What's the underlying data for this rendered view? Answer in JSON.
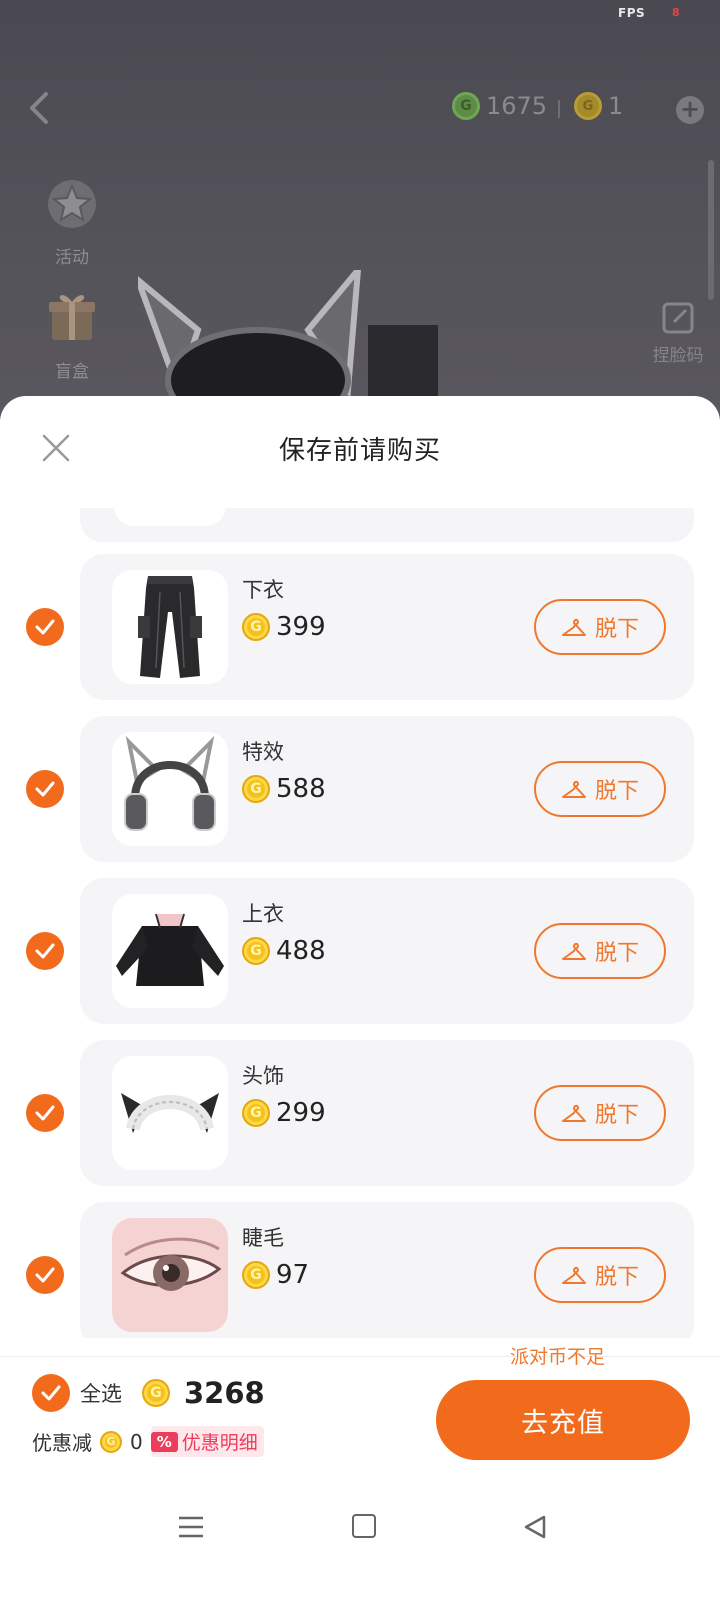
{
  "status": {
    "fps_label": "FPS",
    "fps_value": "8"
  },
  "background": {
    "currency_green": {
      "icon": "game-coin-green-icon",
      "value": "1675"
    },
    "currency_gold": {
      "icon": "party-coin-gold-icon",
      "value": "1"
    },
    "side_menu": [
      {
        "label": "活动",
        "icon": "star-event-icon"
      },
      {
        "label": "盲盒",
        "icon": "gift-box-icon"
      }
    ],
    "face_code_label": "捏脸码"
  },
  "sheet": {
    "title": "保存前请购买",
    "items": [
      {
        "name": "下衣",
        "price": "399",
        "remove_label": "脱下",
        "thumb": "black-cargo-pants"
      },
      {
        "name": "特效",
        "price": "588",
        "remove_label": "脱下",
        "thumb": "cat-ear-headphones"
      },
      {
        "name": "上衣",
        "price": "488",
        "remove_label": "脱下",
        "thumb": "black-off-shoulder-top"
      },
      {
        "name": "头饰",
        "price": "299",
        "remove_label": "脱下",
        "thumb": "maid-cat-headband"
      },
      {
        "name": "睫毛",
        "price": "97",
        "remove_label": "脱下",
        "thumb": "eyelash-eye"
      }
    ]
  },
  "footer": {
    "select_all_label": "全选",
    "total": "3268",
    "discount_label": "优惠减",
    "discount_value": "0",
    "discount_badge": "%",
    "discount_detail": "优惠明细",
    "insufficient_text": "派对币不足",
    "recharge_label": "去充值"
  },
  "colors": {
    "accent": "#f26b1d",
    "accent_text": "#f0782d",
    "card_bg": "#f5f5f7",
    "coin_gold": "#f3c21c",
    "discount_red": "#ee3d5c"
  }
}
